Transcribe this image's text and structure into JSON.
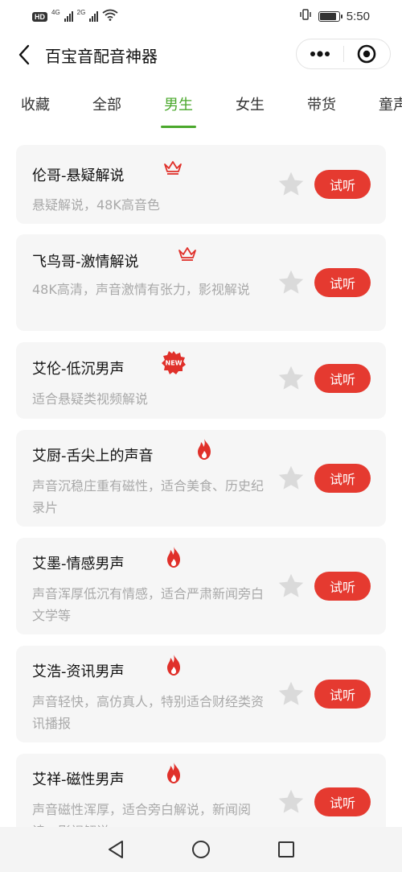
{
  "status_bar": {
    "hd_badge": "HD",
    "net1": "4G",
    "net2": "2G",
    "time": "5:50",
    "battery_level": 0.9
  },
  "header": {
    "title": "百宝音配音神器"
  },
  "tabs": [
    {
      "label": "收藏",
      "active": false
    },
    {
      "label": "全部",
      "active": false
    },
    {
      "label": "男生",
      "active": true
    },
    {
      "label": "女生",
      "active": false
    },
    {
      "label": "带货",
      "active": false
    },
    {
      "label": "童声",
      "active": false
    }
  ],
  "voices": [
    {
      "name": "伦哥-悬疑解说",
      "badge": "crown-icon",
      "desc": "悬疑解说，48K高音色"
    },
    {
      "name": "飞鸟哥-激情解说",
      "badge": "crown-icon",
      "desc": "48K高清，声音激情有张力，影视解说"
    },
    {
      "name": "艾伦-低沉男声",
      "badge": "new-badge-icon",
      "badge_text": "NEW",
      "desc": "适合悬疑类视频解说"
    },
    {
      "name": "艾厨-舌尖上的声音",
      "badge": "fire-icon",
      "desc": "声音沉稳庄重有磁性，适合美食、历史纪录片"
    },
    {
      "name": "艾墨-情感男声",
      "badge": "fire-icon",
      "desc": "声音浑厚低沉有情感，适合严肃新闻旁白文学等"
    },
    {
      "name": "艾浩-资讯男声",
      "badge": "fire-icon",
      "desc": "声音轻快，高仿真人，特别适合财经类资讯播报"
    },
    {
      "name": "艾祥-磁性男声",
      "badge": "fire-icon",
      "desc": "声音磁性浑厚，适合旁白解说，新闻阅读，影视解说"
    }
  ],
  "play_label": "试听",
  "colors": {
    "accent_green": "#4aa82c",
    "play_red": "#e53a30",
    "badge_red": "#e0302a",
    "card_bg": "#f6f6f6"
  }
}
